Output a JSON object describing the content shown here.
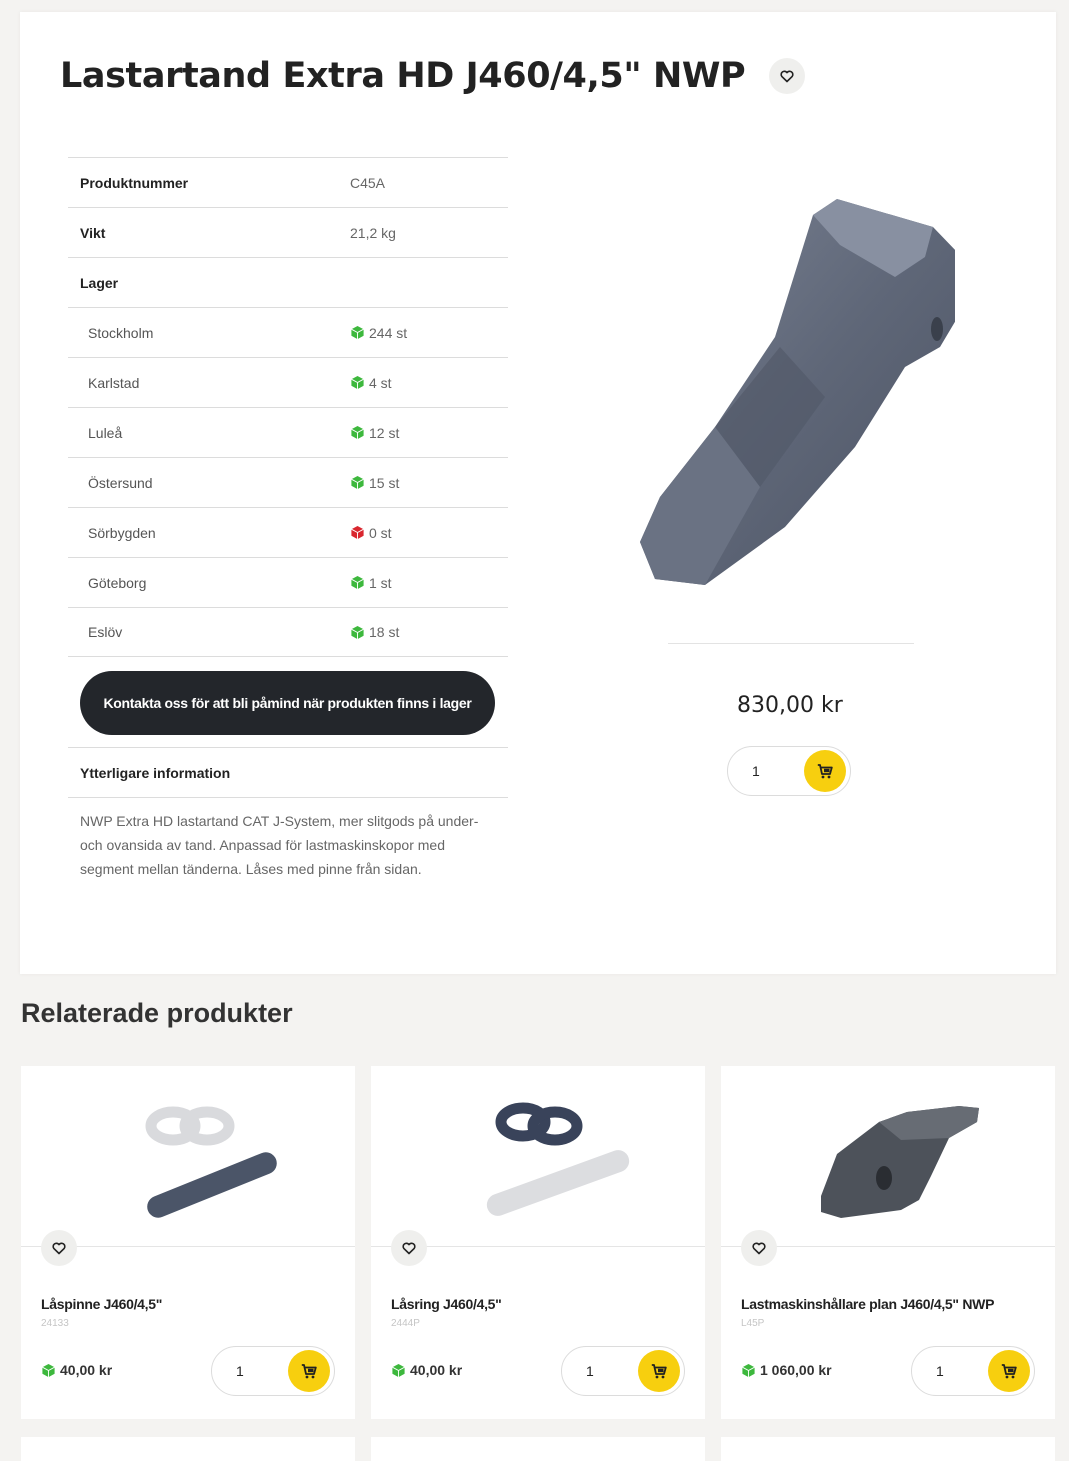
{
  "product": {
    "title": "Lastartand Extra HD J460/4,5\" NWP",
    "specs": [
      {
        "label": "Produktnummer",
        "value": "C45A"
      },
      {
        "label": "Vikt",
        "value": "21,2 kg"
      }
    ],
    "stock_heading": "Lager",
    "stock": [
      {
        "location": "Stockholm",
        "qty": "244 st",
        "status": "in-stock"
      },
      {
        "location": "Karlstad",
        "qty": "4 st",
        "status": "in-stock"
      },
      {
        "location": "Luleå",
        "qty": "12 st",
        "status": "in-stock"
      },
      {
        "location": "Östersund",
        "qty": "15 st",
        "status": "in-stock"
      },
      {
        "location": "Sörbygden",
        "qty": "0 st",
        "status": "out-of-stock"
      },
      {
        "location": "Göteborg",
        "qty": "1 st",
        "status": "in-stock"
      },
      {
        "location": "Eslöv",
        "qty": "18 st",
        "status": "in-stock"
      }
    ],
    "contact_button": "Kontakta oss för att bli påmind när produkten finns i lager",
    "info_heading": "Ytterligare information",
    "info_text": "NWP Extra HD lastartand CAT J-System, mer slitgods på under- och ovansida av tand. Anpassad för lastmaskinskopor med segment mellan tänderna. Låses med pinne från sidan.",
    "price": "830,00 kr",
    "quantity": "1"
  },
  "related": {
    "heading": "Relaterade produkter",
    "items": [
      {
        "name": "Låspinne J460/4,5\"",
        "sku": "24133",
        "price": "40,00 kr",
        "quantity": "1"
      },
      {
        "name": "Låsring J460/4,5\"",
        "sku": "2444P",
        "price": "40,00 kr",
        "quantity": "1"
      },
      {
        "name": "Lastmaskinshållare plan J460/4,5\" NWP",
        "sku": "L45P",
        "price": "1 060,00 kr",
        "quantity": "1"
      }
    ]
  },
  "colors": {
    "accent": "#f7cf0f",
    "in_stock": "#3db83d",
    "out_of_stock": "#d9262e",
    "dark_button": "#23262b"
  },
  "icons": {
    "favorite": "heart-icon",
    "cart": "cart-icon",
    "stock": "box-icon"
  }
}
